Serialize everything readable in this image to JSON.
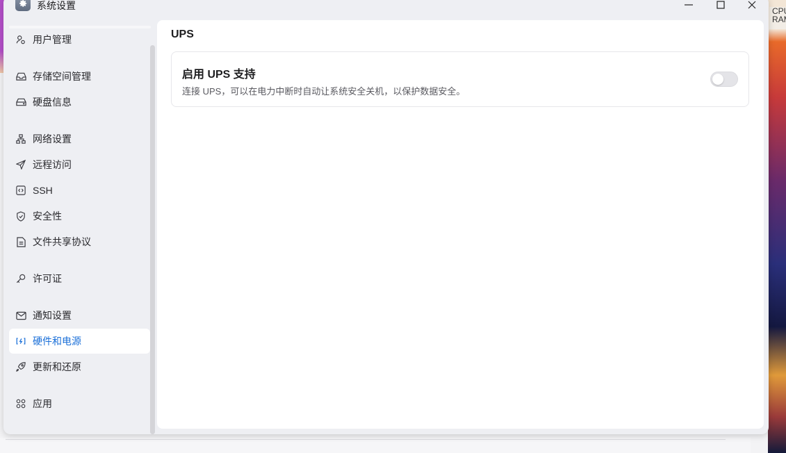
{
  "window": {
    "title": "系统设置",
    "controls": {
      "minimize_icon": "minimize-icon",
      "maximize_icon": "maximize-icon",
      "close_icon": "close-icon"
    }
  },
  "backdrop": {
    "widget_lines": [
      "CPU",
      "RAM"
    ]
  },
  "sidebar": {
    "items": [
      {
        "label": "用户管理",
        "icon": "user-icon"
      },
      {
        "label": "存储空间管理",
        "icon": "storage-icon"
      },
      {
        "label": "硬盘信息",
        "icon": "disk-icon"
      },
      {
        "label": "网络设置",
        "icon": "network-icon"
      },
      {
        "label": "远程访问",
        "icon": "send-icon"
      },
      {
        "label": "SSH",
        "icon": "code-icon"
      },
      {
        "label": "安全性",
        "icon": "shield-icon"
      },
      {
        "label": "文件共享协议",
        "icon": "file-icon"
      },
      {
        "label": "许可证",
        "icon": "key-icon"
      },
      {
        "label": "通知设置",
        "icon": "mail-icon"
      },
      {
        "label": "硬件和电源",
        "icon": "power-icon",
        "active": true
      },
      {
        "label": "更新和还原",
        "icon": "rocket-icon"
      },
      {
        "label": "应用",
        "icon": "apps-icon"
      }
    ]
  },
  "main": {
    "section_title": "UPS",
    "card": {
      "title": "启用 UPS 支持",
      "description": "连接 UPS，可以在电力中断时自动让系统安全关机，以保护数据安全。",
      "toggle_on": false
    }
  },
  "colors": {
    "accent": "#1a6fd8",
    "panel": "#ffffff",
    "window_bg": "#eeeff3"
  }
}
